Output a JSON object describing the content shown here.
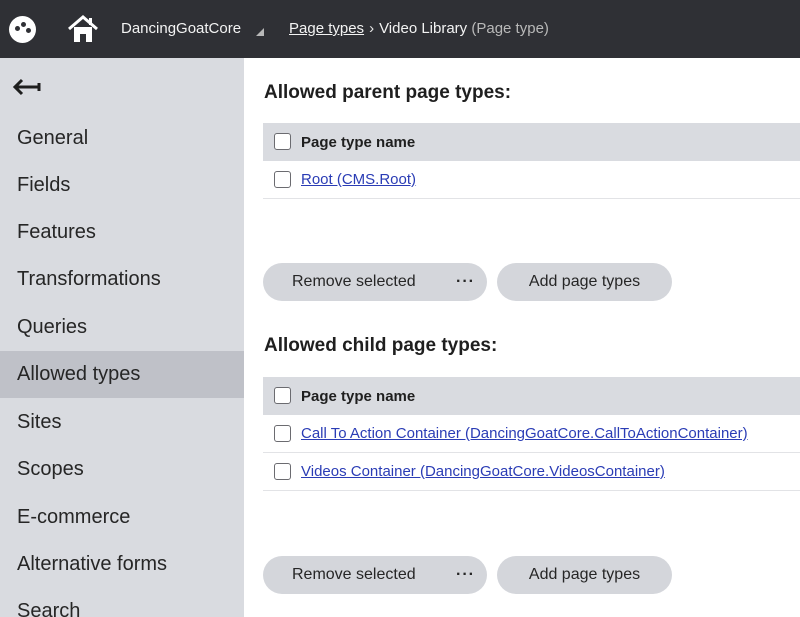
{
  "topbar": {
    "site_name": "DancingGoatCore",
    "breadcrumb": {
      "link": "Page types",
      "separator": "›",
      "current": "Video Library",
      "current_type": "(Page type)"
    }
  },
  "sidebar": {
    "items": [
      {
        "label": "General"
      },
      {
        "label": "Fields"
      },
      {
        "label": "Features"
      },
      {
        "label": "Transformations"
      },
      {
        "label": "Queries"
      },
      {
        "label": "Allowed types",
        "active": true
      },
      {
        "label": "Sites"
      },
      {
        "label": "Scopes"
      },
      {
        "label": "E-commerce"
      },
      {
        "label": "Alternative forms"
      },
      {
        "label": "Search"
      }
    ]
  },
  "parent_section": {
    "title": "Allowed parent page types:",
    "column_header": "Page type name",
    "rows": [
      "Root (CMS.Root)"
    ],
    "remove_label": "Remove selected",
    "more_label": "···",
    "add_label": "Add page types"
  },
  "child_section": {
    "title": "Allowed child page types:",
    "column_header": "Page type name",
    "rows": [
      "Call To Action Container (DancingGoatCore.CallToActionContainer)",
      "Videos Container (DancingGoatCore.VideosContainer)"
    ],
    "remove_label": "Remove selected",
    "more_label": "···",
    "add_label": "Add page types"
  }
}
